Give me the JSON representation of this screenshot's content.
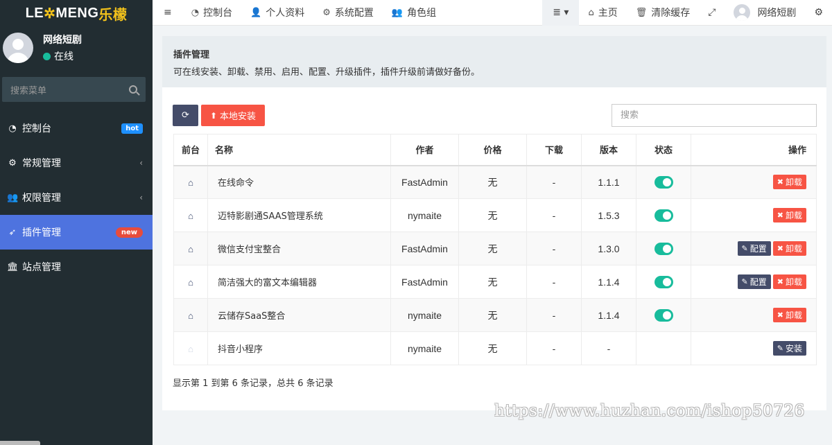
{
  "logo": {
    "part1": "LE",
    "part2": "✲",
    "part3": "MENG",
    "part4": "乐檬"
  },
  "user": {
    "name": "网络短剧",
    "status": "在线"
  },
  "sidebar_search": {
    "placeholder": "搜索菜单"
  },
  "menu": [
    {
      "icon": "dashboard-icon",
      "glyph": "◔",
      "label": "控制台",
      "badge": "hot"
    },
    {
      "icon": "cogs-icon",
      "glyph": "⚙",
      "label": "常规管理",
      "chevron": "‹"
    },
    {
      "icon": "users-icon",
      "glyph": "👥",
      "label": "权限管理",
      "chevron": "‹"
    },
    {
      "icon": "rocket-icon",
      "glyph": "➶",
      "label": "插件管理",
      "badge": "new",
      "active": true
    },
    {
      "icon": "bank-icon",
      "glyph": "🏛",
      "label": "站点管理"
    }
  ],
  "topnav": {
    "menu_toggle": "≡",
    "tabs": [
      {
        "glyph": "◔",
        "label": "控制台"
      },
      {
        "glyph": "👤",
        "label": "个人资料"
      },
      {
        "glyph": "⚙",
        "label": "系统配置"
      },
      {
        "glyph": "👥",
        "label": "角色组"
      }
    ],
    "dropdown": "≣ ▾",
    "home": {
      "glyph": "⌂",
      "label": "主页"
    },
    "clear_cache": {
      "glyph": "🗑",
      "label": "清除缓存"
    },
    "fullscreen": "⤢",
    "user_name": "网络短剧",
    "settings": "⚙"
  },
  "panel": {
    "title": "插件管理",
    "description": "可在线安装、卸载、禁用、启用、配置、升级插件，插件升级前请做好备份。"
  },
  "toolbar": {
    "refresh": "⟳",
    "install_label": "本地安装",
    "install_icon": "⬆"
  },
  "search": {
    "placeholder": "搜索"
  },
  "table": {
    "headers": [
      "前台",
      "名称",
      "作者",
      "价格",
      "下载",
      "版本",
      "状态",
      "操作"
    ],
    "rows": [
      {
        "name": "在线命令",
        "author": "FastAdmin",
        "price": "无",
        "downloads": "-",
        "version": "1.1.1",
        "enabled": true,
        "actions": [
          "卸载"
        ]
      },
      {
        "name": "迈特影剧通SAAS管理系统",
        "author": "nymaite",
        "price": "无",
        "downloads": "-",
        "version": "1.5.3",
        "enabled": true,
        "actions": [
          "卸载"
        ]
      },
      {
        "name": "微信支付宝整合",
        "author": "FastAdmin",
        "price": "无",
        "downloads": "-",
        "version": "1.3.0",
        "enabled": true,
        "actions": [
          "配置",
          "卸载"
        ]
      },
      {
        "name": "简洁强大的富文本编辑器",
        "author": "FastAdmin",
        "price": "无",
        "downloads": "-",
        "version": "1.1.4",
        "enabled": true,
        "actions": [
          "配置",
          "卸载"
        ]
      },
      {
        "name": "云储存SaaS整合",
        "author": "nymaite",
        "price": "无",
        "downloads": "-",
        "version": "1.1.4",
        "enabled": true,
        "actions": [
          "卸载"
        ]
      },
      {
        "name": "抖音小程序",
        "author": "nymaite",
        "price": "无",
        "downloads": "-",
        "version": "-",
        "enabled": null,
        "actions": [
          "安装"
        ]
      }
    ]
  },
  "pager": {
    "info": "显示第 1 到第 6 条记录，总共 6 条记录"
  },
  "watermark": "https://www.huzhan.com/ishop50726"
}
